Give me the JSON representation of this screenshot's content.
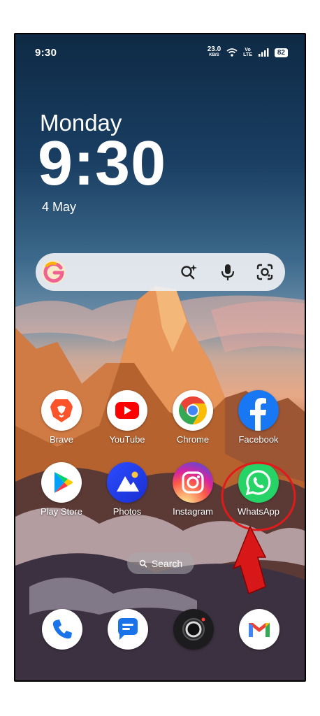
{
  "status_bar": {
    "time": "9:30",
    "speed_value": "23.0",
    "speed_unit": "KB/S",
    "volte_top": "Vo",
    "volte_bottom": "LTE",
    "battery": "82"
  },
  "lock": {
    "day": "Monday",
    "clock": "9:30",
    "date": "4 May"
  },
  "search_bar": {
    "g_icon": "google-g-icon",
    "lens": "lens-sparkle-icon",
    "mic": "mic-icon",
    "camera": "camera-icon"
  },
  "apps_row1": [
    {
      "name": "Brave",
      "icon": "brave-icon"
    },
    {
      "name": "YouTube",
      "icon": "youtube-icon"
    },
    {
      "name": "Chrome",
      "icon": "chrome-icon"
    },
    {
      "name": "Facebook",
      "icon": "facebook-icon"
    }
  ],
  "apps_row2": [
    {
      "name": "Play Store",
      "icon": "play-store-icon"
    },
    {
      "name": "Photos",
      "icon": "photos-icon"
    },
    {
      "name": "Instagram",
      "icon": "instagram-icon"
    },
    {
      "name": "WhatsApp",
      "icon": "whatsapp-icon"
    }
  ],
  "search_pill": {
    "label": "Search"
  },
  "dock": [
    "phone-icon",
    "messages-icon",
    "camera-icon",
    "gmail-icon"
  ],
  "colors": {
    "annotation_red": "#e01a1a",
    "whatsapp_green": "#25d366",
    "youtube_red": "#ff0000",
    "facebook_blue": "#1877f2",
    "brave_orange": "#fb542b"
  }
}
